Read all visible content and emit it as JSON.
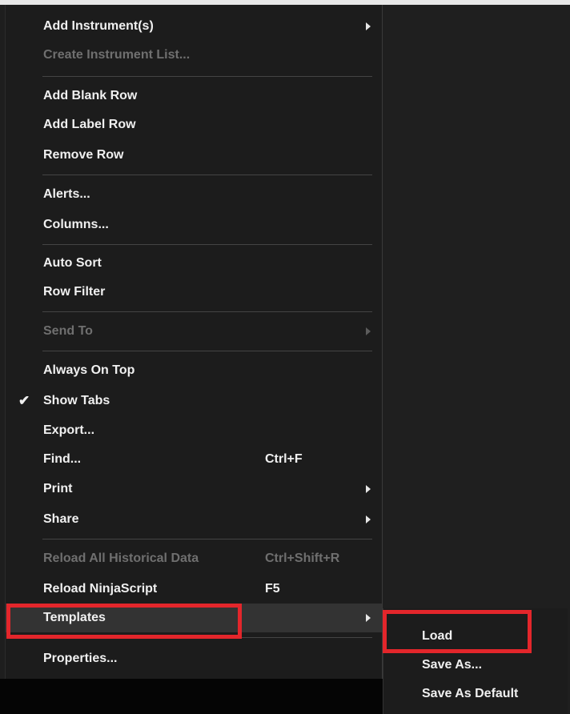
{
  "menu": {
    "add_instruments": "Add Instrument(s)",
    "create_instrument_list": "Create Instrument List...",
    "add_blank_row": "Add Blank Row",
    "add_label_row": "Add Label Row",
    "remove_row": "Remove Row",
    "alerts": "Alerts...",
    "columns": "Columns...",
    "auto_sort": "Auto Sort",
    "row_filter": "Row Filter",
    "send_to": "Send To",
    "always_on_top": "Always On Top",
    "show_tabs": "Show Tabs",
    "show_tabs_check": "✔",
    "export": "Export...",
    "find": "Find...",
    "find_shortcut": "Ctrl+F",
    "print": "Print",
    "share": "Share",
    "reload_historical": "Reload All Historical Data",
    "reload_historical_shortcut": "Ctrl+Shift+R",
    "reload_ninjascript": "Reload NinjaScript",
    "reload_ninjascript_shortcut": "F5",
    "templates": "Templates",
    "properties": "Properties..."
  },
  "submenu": {
    "load": "Load",
    "save_as": "Save As...",
    "save_as_default": "Save As Default"
  },
  "colors": {
    "highlight_outline": "#e3262b",
    "menu_background": "#1c1c1c",
    "disabled_text": "#6f6f6f"
  },
  "icons": {
    "checkmark": "checkmark-icon",
    "submenu_arrow": "chevron-right-icon"
  }
}
